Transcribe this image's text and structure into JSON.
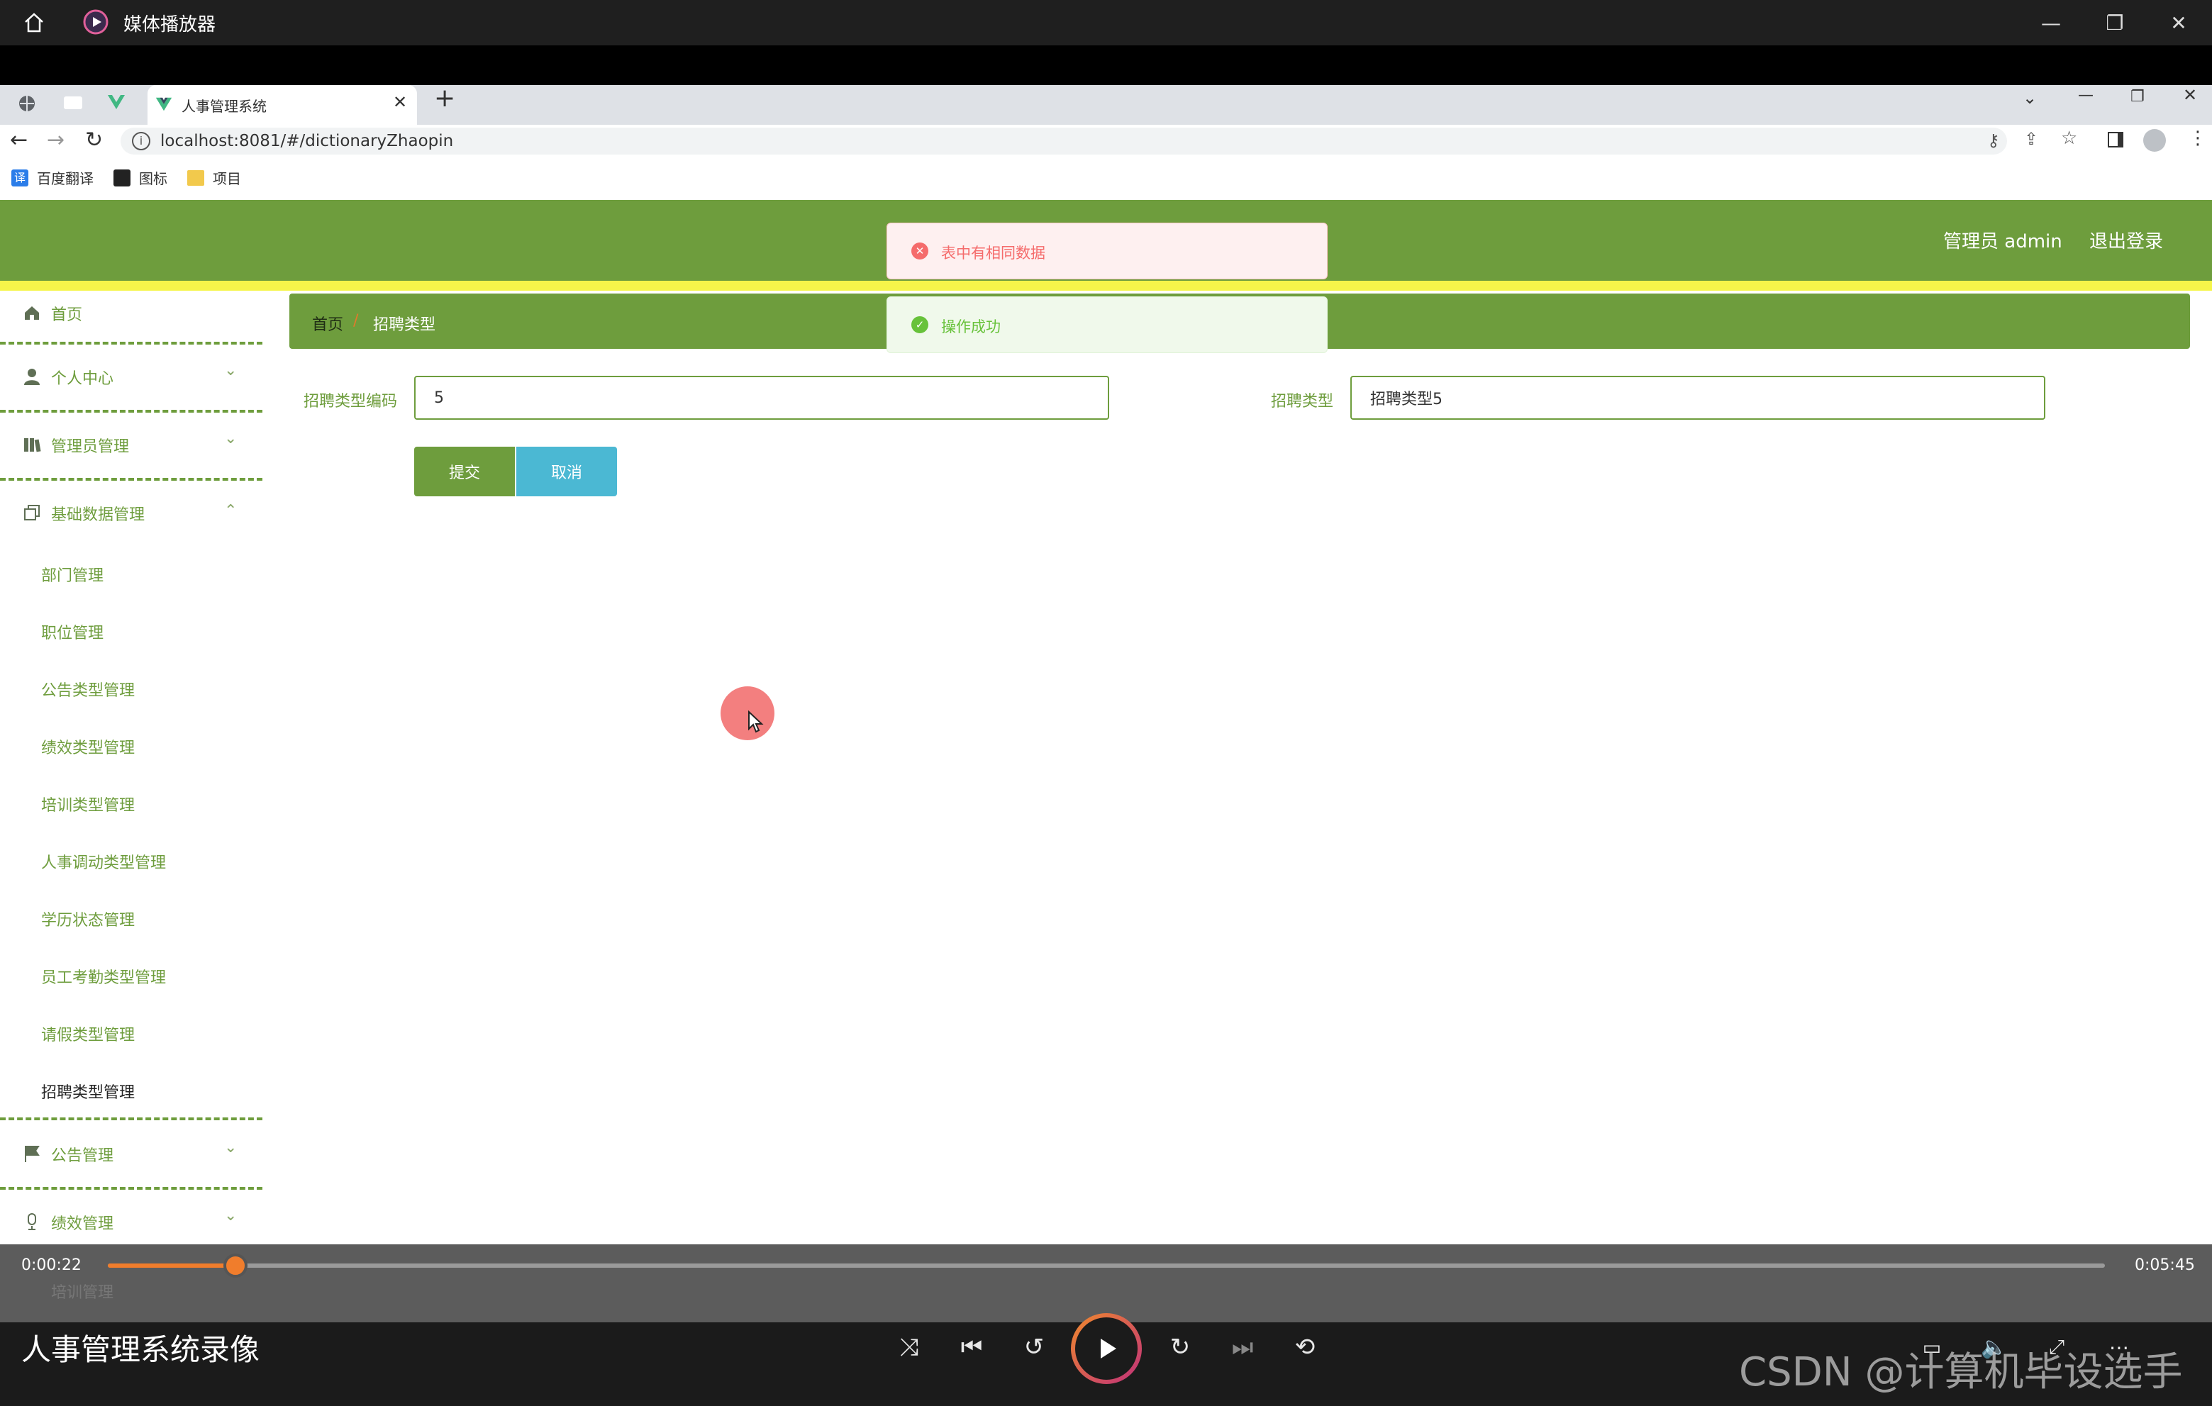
{
  "player": {
    "app_name": "媒体播放器",
    "video_title": "人事管理系统录像",
    "time_current": "0:00:22",
    "time_total": "0:05:45",
    "progress_fraction": 0.064,
    "accent_color": "#f07d2c"
  },
  "browser": {
    "tab_title": "人事管理系统",
    "url": "localhost:8081/#/dictionaryZhaopin",
    "bookmarks": [
      "百度翻译",
      "图标",
      "项目"
    ]
  },
  "app": {
    "header_color": "#6e9d3d",
    "user_label": "管理员 admin",
    "logout_label": "退出登录",
    "toast_error": "表中有相同数据",
    "toast_success": "操作成功",
    "breadcrumb": {
      "home": "首页",
      "separator": "/",
      "current": "招聘类型"
    },
    "form": {
      "code_label": "招聘类型编码",
      "code_value": "5",
      "type_label": "招聘类型",
      "type_value": "招聘类型5",
      "submit_label": "提交",
      "cancel_label": "取消"
    },
    "sidebar": {
      "home": "首页",
      "personal_center": "个人中心",
      "admin_manage": "管理员管理",
      "base_data": "基础数据管理",
      "sub_items": [
        "部门管理",
        "职位管理",
        "公告类型管理",
        "绩效类型管理",
        "培训类型管理",
        "人事调动类型管理",
        "学历状态管理",
        "员工考勤类型管理",
        "请假类型管理",
        "招聘类型管理"
      ],
      "notice_manage": "公告管理",
      "perf_manage": "绩效管理",
      "training_manage": "培训管理"
    }
  },
  "watermark": "CSDN @计算机毕设选手"
}
